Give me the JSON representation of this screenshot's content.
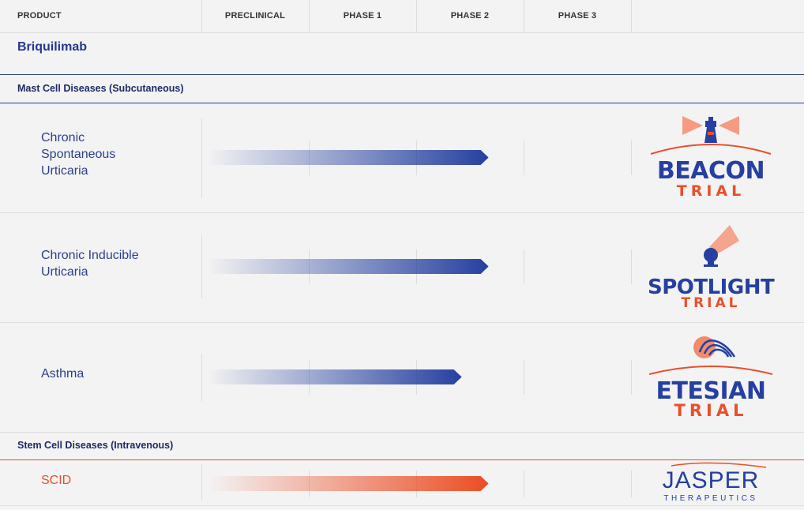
{
  "chart_data": {
    "type": "bar",
    "orientation": "horizontal",
    "columns": [
      "PRODUCT",
      "PRECLINICAL",
      "PHASE 1",
      "PHASE 2",
      "PHASE 3",
      ""
    ],
    "phase_stages": [
      "PRECLINICAL",
      "PHASE 1",
      "PHASE 2",
      "PHASE 3"
    ],
    "product": "Briquilimab",
    "sections": [
      {
        "name": "Mast Cell Diseases (Subcutaneous)",
        "indications": [
          {
            "lines": [
              "Chronic",
              "Spontaneous",
              "Urticaria"
            ],
            "progress_phases": 2.6,
            "color": "#2540a0",
            "trial": {
              "main": "BEACON",
              "sub": "TRIAL",
              "icon": "lighthouse-icon"
            }
          },
          {
            "lines": [
              "Chronic Inducible",
              "Urticaria"
            ],
            "progress_phases": 2.6,
            "color": "#2540a0",
            "trial": {
              "main": "SPOTLIGHT",
              "sub": "TRIAL",
              "icon": "spotlight-icon"
            }
          },
          {
            "lines": [
              "Asthma"
            ],
            "progress_phases": 2.35,
            "color": "#2540a0",
            "trial": {
              "main": "ETESIAN",
              "sub": "TRIAL",
              "icon": "wind-wave-icon"
            }
          }
        ]
      },
      {
        "name": "Stem Cell Diseases (Intravenous)",
        "indications": [
          {
            "lines": [
              "SCID"
            ],
            "progress_phases": 2.6,
            "color": "#ec4d24",
            "trial": {
              "main": "JASPER",
              "sub": "THERAPEUTICS",
              "icon": "jasper-arc-icon"
            }
          }
        ]
      }
    ],
    "colors": {
      "mast": "#2540a0",
      "stem": "#ec4d24",
      "text_dark": "#1c2b66"
    }
  }
}
